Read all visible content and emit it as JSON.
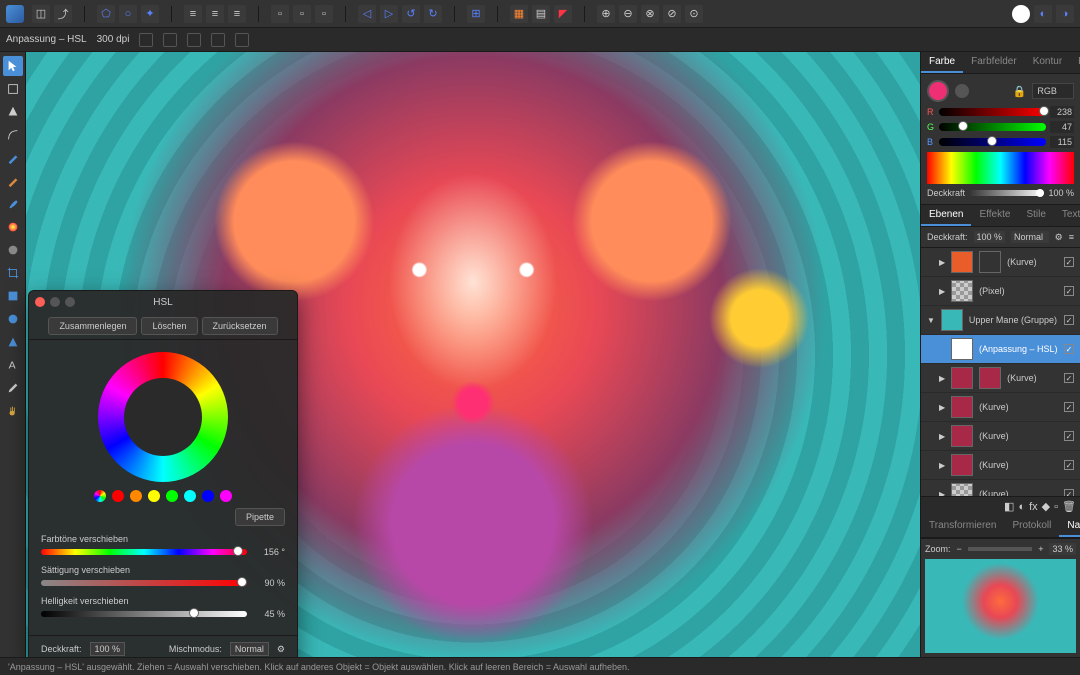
{
  "context": {
    "doc_label": "Anpassung – HSL",
    "dpi": "300 dpi"
  },
  "color_panel": {
    "tabs": [
      "Farbe",
      "Farbfelder",
      "Kontur",
      "Pinsel"
    ],
    "active_tab": 0,
    "mode": "RGB",
    "r": 238,
    "g": 47,
    "b": 115,
    "r_pct": 93,
    "g_pct": 18,
    "b_pct": 45,
    "opacity_label": "Deckkraft",
    "opacity": "100 %"
  },
  "layers_panel": {
    "tabs": [
      "Ebenen",
      "Effekte",
      "Stile",
      "Textstile"
    ],
    "active_tab": 0,
    "opacity_label": "Deckkraft:",
    "opacity": "100 %",
    "blend": "Normal",
    "items": [
      {
        "name": "(Kurve)",
        "indent": 1,
        "thumb": "#e85d2a",
        "thumb2": "#333"
      },
      {
        "name": "(Pixel)",
        "indent": 1,
        "thumb": "checker"
      },
      {
        "name": "Upper Mane (Gruppe)",
        "indent": 0,
        "thumb": "#39b8b8",
        "expanded": true
      },
      {
        "name": "(Anpassung – HSL)",
        "indent": 2,
        "thumb": "#fff",
        "selected": true
      },
      {
        "name": "(Kurve)",
        "indent": 1,
        "thumb": "#a82848",
        "thumb2": "#a82848"
      },
      {
        "name": "(Kurve)",
        "indent": 1,
        "thumb": "#a82848"
      },
      {
        "name": "(Kurve)",
        "indent": 1,
        "thumb": "#a82848"
      },
      {
        "name": "(Kurve)",
        "indent": 1,
        "thumb": "#a82848"
      },
      {
        "name": "(Kurve)",
        "indent": 1,
        "thumb": "checker"
      }
    ]
  },
  "navigator": {
    "tabs": [
      "Transformieren",
      "Protokoll",
      "Navigator"
    ],
    "active_tab": 2,
    "zoom_label": "Zoom:",
    "zoom": "33 %"
  },
  "hsl": {
    "title": "HSL",
    "merge": "Zusammenlegen",
    "delete": "Löschen",
    "reset": "Zurücksetzen",
    "pipette": "Pipette",
    "hue_label": "Farbtöne verschieben",
    "hue_val": "156 °",
    "hue_pct": 93,
    "sat_label": "Sättigung verschieben",
    "sat_val": "90 %",
    "sat_pct": 95,
    "light_label": "Helligkeit verschieben",
    "light_val": "45 %",
    "light_pct": 72,
    "opacity_label": "Deckkraft:",
    "opacity": "100 %",
    "blend_label": "Mischmodus:",
    "blend": "Normal",
    "swatches": [
      "conic",
      "#ff0000",
      "#ff8800",
      "#ffff00",
      "#00ff00",
      "#00ffff",
      "#0000ff",
      "#ff00ff"
    ]
  },
  "status": "'Anpassung – HSL' ausgewählt. Ziehen = Auswahl verschieben. Klick auf anderes Objekt = Objekt auswählen. Klick auf leeren Bereich = Auswahl aufheben."
}
